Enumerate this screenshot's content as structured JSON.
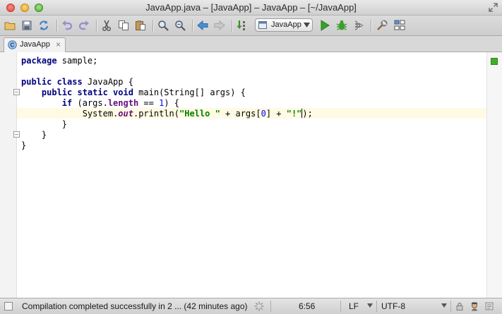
{
  "window": {
    "title": "JavaApp.java – [JavaApp] – JavaApp – [~/JavaApp]"
  },
  "toolbar": {
    "icons": [
      "open-folder-icon",
      "save-icon",
      "sync-icon",
      "undo-icon",
      "redo-icon",
      "cut-icon",
      "copy-icon",
      "paste-icon",
      "find-icon",
      "replace-icon",
      "back-icon",
      "forward-icon",
      "make-project-icon",
      "run-icon",
      "debug-icon",
      "coverage-icon",
      "settings-icon",
      "project-structure-icon"
    ],
    "run_config": "JavaApp"
  },
  "tabs": [
    {
      "label": "JavaApp",
      "close": "×",
      "icon": "java-class-icon"
    }
  ],
  "editor": {
    "lines": [
      "package sample;",
      "",
      "public class JavaApp {",
      "    public static void main(String[] args) {",
      "        if (args.length == 1) {",
      "            System.out.println(\"Hello \" + args[0] + \"!\");",
      "        }",
      "    }",
      "}"
    ],
    "current_line": 6,
    "inspection_status": "ok",
    "colors": {
      "keyword": "#000080",
      "string": "#008000",
      "number": "#0000ff",
      "field": "#660e7a",
      "current_line_bg": "#fffae3"
    }
  },
  "statusbar": {
    "message": "Compilation completed successfully in 2 ... (42 minutes ago)",
    "position": "6:56",
    "line_separator": "LF",
    "encoding": "UTF-8"
  }
}
